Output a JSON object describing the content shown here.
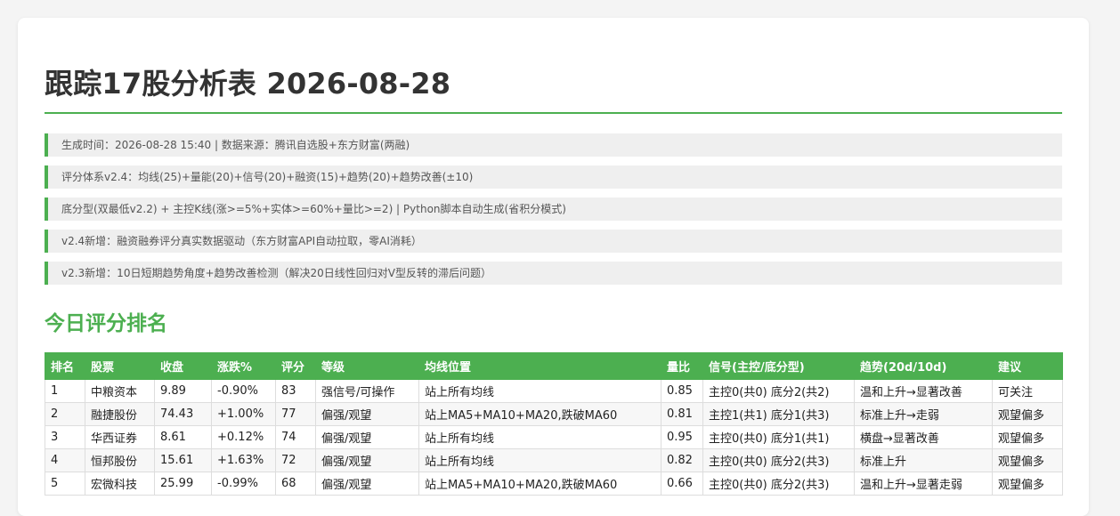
{
  "title": "跟踪17股分析表 2026-08-28",
  "notes": [
    "生成时间：2026-08-28 15:40 | 数据来源：腾讯自选股+东方财富(两融)",
    "评分体系v2.4：均线(25)+量能(20)+信号(20)+融资(15)+趋势(20)+趋势改善(±10)",
    "底分型(双最低v2.2) + 主控K线(涨>=5%+实体>=60%+量比>=2) | Python脚本自动生成(省积分模式)",
    "v2.4新增：融资融券评分真实数据驱动（东方财富API自动拉取，零AI消耗）",
    "v2.3新增：10日短期趋势角度+趋势改善检测（解决20日线性回归对V型反转的滞后问题）"
  ],
  "section_title": "今日评分排名",
  "table": {
    "headers": [
      "排名",
      "股票",
      "收盘",
      "涨跌%",
      "评分",
      "等级",
      "均线位置",
      "量比",
      "信号(主控/底分型)",
      "趋势(20d/10d)",
      "建议"
    ],
    "rows": [
      [
        "1",
        "中粮资本",
        "9.89",
        "-0.90%",
        "83",
        "强信号/可操作",
        "站上所有均线",
        "0.85",
        "主控0(共0) 底分2(共2)",
        "温和上升→显著改善",
        "可关注"
      ],
      [
        "2",
        "融捷股份",
        "74.43",
        "+1.00%",
        "77",
        "偏强/观望",
        "站上MA5+MA10+MA20,跌破MA60",
        "0.81",
        "主控1(共1) 底分1(共3)",
        "标准上升→走弱",
        "观望偏多"
      ],
      [
        "3",
        "华西证券",
        "8.61",
        "+0.12%",
        "74",
        "偏强/观望",
        "站上所有均线",
        "0.95",
        "主控0(共0) 底分1(共1)",
        "横盘→显著改善",
        "观望偏多"
      ],
      [
        "4",
        "恒邦股份",
        "15.61",
        "+1.63%",
        "72",
        "偏强/观望",
        "站上所有均线",
        "0.82",
        "主控0(共0) 底分2(共3)",
        "标准上升",
        "观望偏多"
      ],
      [
        "5",
        "宏微科技",
        "25.99",
        "-0.99%",
        "68",
        "偏强/观望",
        "站上MA5+MA10+MA20,跌破MA60",
        "0.66",
        "主控0(共0) 底分2(共3)",
        "温和上升→显著走弱",
        "观望偏多"
      ]
    ]
  }
}
